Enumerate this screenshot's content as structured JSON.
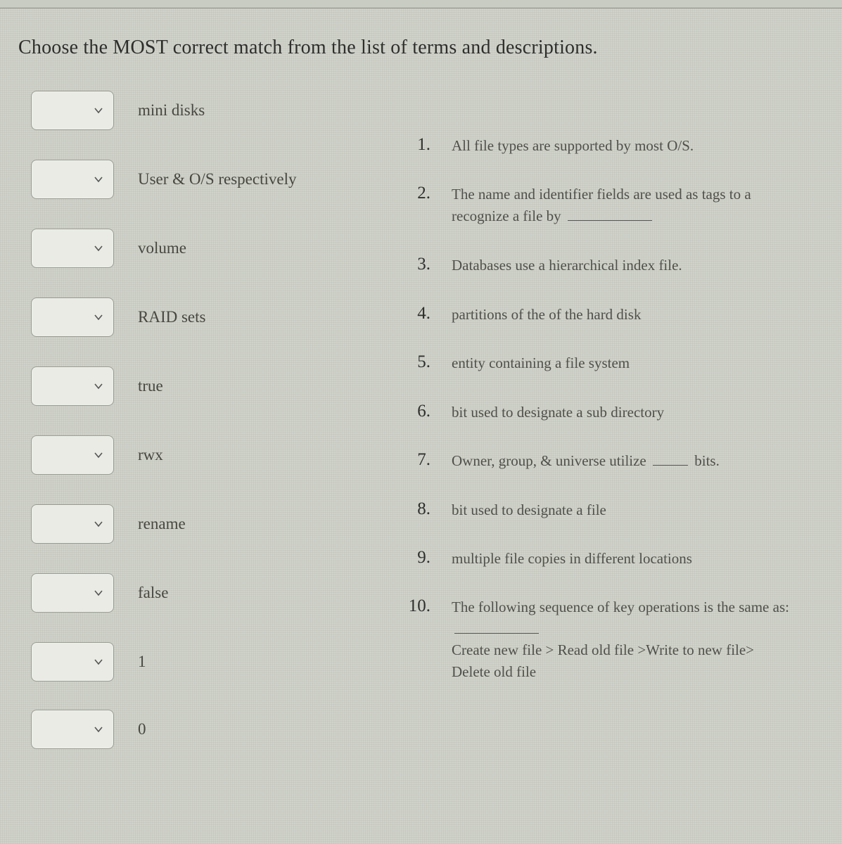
{
  "instruction": "Choose the MOST correct match from the list of terms and descriptions.",
  "terms": [
    "mini disks",
    "User & O/S respectively",
    "volume",
    "RAID sets",
    "true",
    "rwx",
    "rename",
    "false",
    "1",
    "0"
  ],
  "descriptions": [
    {
      "n": "1.",
      "text_pre": "All file types are supported by most O/S."
    },
    {
      "n": "2.",
      "text_pre": "The name and identifier fields are used as tags to a recognize a file by",
      "blank_after": true
    },
    {
      "n": "3.",
      "text_pre": "Databases use a hierarchical index file."
    },
    {
      "n": "4.",
      "text_pre": "partitions of the of the hard disk"
    },
    {
      "n": "5.",
      "text_pre": "entity containing a file system"
    },
    {
      "n": "6.",
      "text_pre": "bit used to designate a sub directory"
    },
    {
      "n": "7.",
      "text_pre": "Owner, group, & universe utilize",
      "blank_inline": true,
      "text_post": "bits."
    },
    {
      "n": "8.",
      "text_pre": "bit used to designate a file"
    },
    {
      "n": "9.",
      "text_pre": "multiple file copies in different locations"
    },
    {
      "n": "10.",
      "text_pre": "The following sequence of key operations is the same as:",
      "blank_after_long": true,
      "text_post2": "Create new file > Read old file >Write to new file> Delete old file"
    }
  ]
}
